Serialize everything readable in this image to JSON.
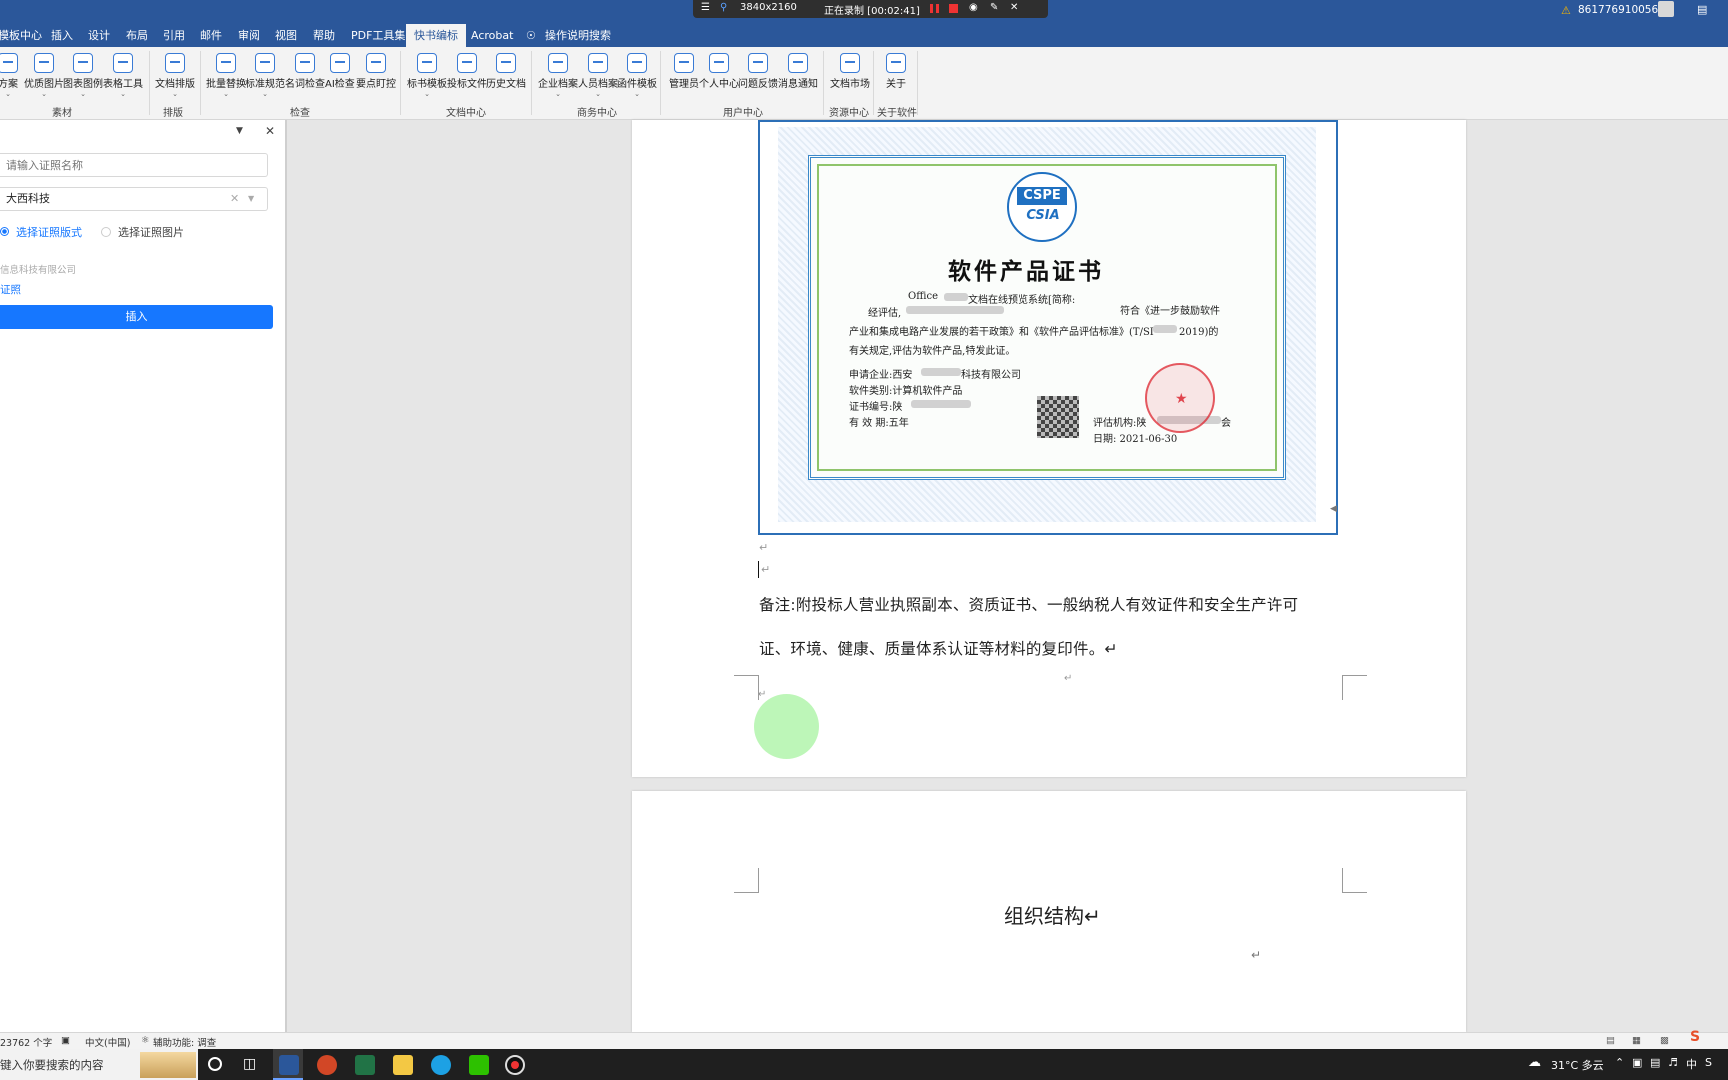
{
  "title_bar": {
    "tabs": [
      "模板中心",
      "插入",
      "设计",
      "布局",
      "引用",
      "邮件",
      "审阅",
      "视图",
      "帮助",
      "PDF工具集",
      "快书编标",
      "Acrobat"
    ],
    "active_tab": "快书编标",
    "tell_me": "操作说明搜索",
    "account": "8617769100565",
    "warning_icon": "warning-icon"
  },
  "recorder": {
    "resolution": "3840x2160",
    "status": "正在录制 [00:02:41]"
  },
  "ribbon": {
    "buttons": [
      "方案",
      "优质图片",
      "图表图例",
      "表格工具",
      "文档排版",
      "批量替换",
      "标准规范",
      "名词检查",
      "AI检查",
      "要点盯控",
      "标书模板",
      "投标文件",
      "历史文档",
      "企业档案",
      "人员档案",
      "函件模板",
      "管理员",
      "个人中心",
      "问题反馈",
      "消息通知",
      "文档市场",
      "关于"
    ],
    "groups": [
      "素材",
      "排版",
      "检查",
      "文档中心",
      "商务中心",
      "用户中心",
      "资源中心",
      "关于软件"
    ]
  },
  "panel": {
    "search_placeholder": "请输入证照名称",
    "company_select": "大西科技",
    "radio_layout": "选择证照版式",
    "radio_image": "选择证照图片",
    "tree_company": "信息科技有限公司",
    "tree_item": "证照",
    "insert_button": "插入"
  },
  "document": {
    "cert": {
      "org_logo_text": "CSPE",
      "org_logo_sub": "CSIA",
      "title": "软件产品证书",
      "line1": "Office",
      "line1b": "文档在线预览系统[简称:",
      "line2a": "经评估,",
      "line2b": "符合《进一步鼓励软件",
      "line3": "产业和集成电路产业发展的若干政策》和《软件产品评估标准》(T/SI",
      "line3b": "2019)的",
      "line4": "有关规定,评估为软件产品,特发此证。",
      "applicant": "申请企业:西安",
      "applicant_b": "科技有限公司",
      "category": "软件类别:计算机软件产品",
      "cert_no": "证书编号:陕",
      "validity": "有 效 期:五年",
      "evaluator": "评估机构:陕",
      "evaluator_b": "会",
      "date": "日期: 2021-06-30"
    },
    "note_line1": "备注:附投标人营业执照副本、资质证书、一般纳税人有效证件和安全生产许可",
    "note_line2": "证、环境、健康、质量体系认证等材料的复印件。↵",
    "para_mark": "↵",
    "heading": "组织结构↵"
  },
  "status": {
    "word_count": "23762 个字",
    "language": "中文(中国)",
    "accessibility": "辅助功能: 调查"
  },
  "taskbar": {
    "search": "键入你要搜索的内容",
    "weather": "31°C 多云",
    "ime": "中"
  },
  "colors": {
    "title_bar": "#2b579a",
    "accent_blue": "#1677ff",
    "cursor_highlight": "#b6f5b0"
  }
}
